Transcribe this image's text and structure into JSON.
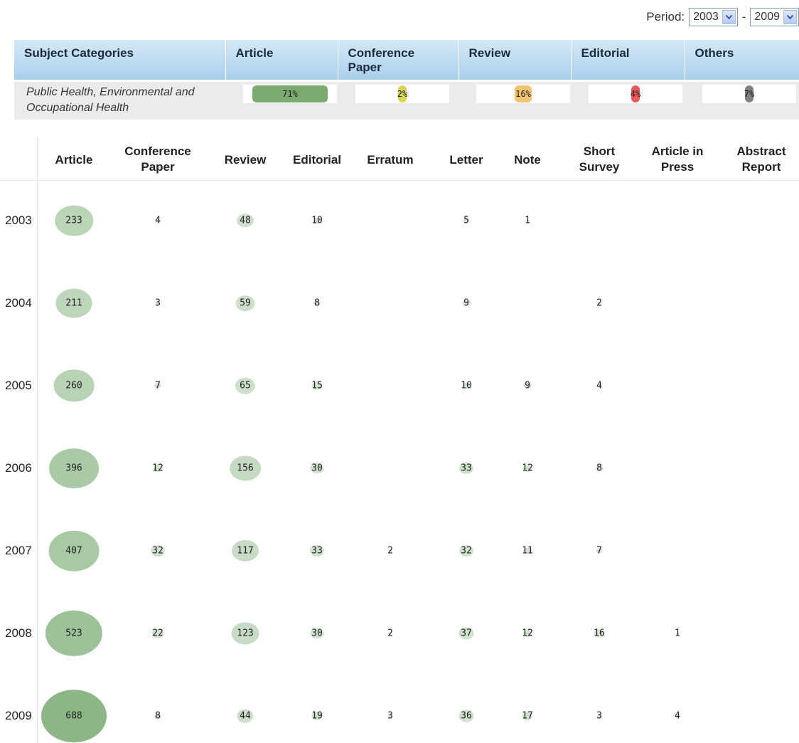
{
  "period": {
    "label": "Period:",
    "from": "2003",
    "separator": "-",
    "to": "2009"
  },
  "summary": {
    "headers": [
      "Subject Categories",
      "Article",
      "Conference Paper",
      "Review",
      "Editorial",
      "Others"
    ],
    "subject": "Public Health, Environmental and Occupational Health",
    "items": [
      {
        "label": "71%",
        "value": 71,
        "color": "#7aaa6f"
      },
      {
        "label": "2%",
        "value": 2,
        "color": "#d8d455"
      },
      {
        "label": "16%",
        "value": 16,
        "color": "#f2c36e"
      },
      {
        "label": "4%",
        "value": 4,
        "color": "#ea5a5a"
      },
      {
        "label": "7%",
        "value": 7,
        "color": "#808080"
      }
    ]
  },
  "chart_data": {
    "type": "table",
    "columns": [
      "Article",
      "Conference Paper",
      "Review",
      "Editorial",
      "Erratum",
      "Letter",
      "Note",
      "Short Survey",
      "Article in Press",
      "Abstract Report"
    ],
    "column_lines": [
      [
        "Article"
      ],
      [
        "Conference",
        "Paper"
      ],
      [
        "Review"
      ],
      [
        "Editorial"
      ],
      [
        "Erratum"
      ],
      [
        "Letter"
      ],
      [
        "Note"
      ],
      [
        "Short",
        "Survey"
      ],
      [
        "Article in",
        "Press"
      ],
      [
        "Abstract",
        "Report"
      ]
    ],
    "rows": [
      {
        "year": "2003",
        "values": [
          233,
          4,
          48,
          10,
          null,
          5,
          1,
          null,
          null,
          null
        ]
      },
      {
        "year": "2004",
        "values": [
          211,
          3,
          59,
          8,
          null,
          9,
          null,
          2,
          null,
          null
        ]
      },
      {
        "year": "2005",
        "values": [
          260,
          7,
          65,
          15,
          null,
          10,
          9,
          4,
          null,
          null
        ]
      },
      {
        "year": "2006",
        "values": [
          396,
          12,
          156,
          30,
          null,
          33,
          12,
          8,
          null,
          null
        ]
      },
      {
        "year": "2007",
        "values": [
          407,
          32,
          117,
          33,
          2,
          32,
          11,
          7,
          null,
          null
        ]
      },
      {
        "year": "2008",
        "values": [
          523,
          22,
          123,
          30,
          2,
          37,
          12,
          16,
          1,
          null
        ]
      },
      {
        "year": "2009",
        "values": [
          688,
          8,
          44,
          19,
          3,
          36,
          17,
          3,
          4,
          null
        ]
      }
    ],
    "bubble_color": "#6fa468"
  }
}
